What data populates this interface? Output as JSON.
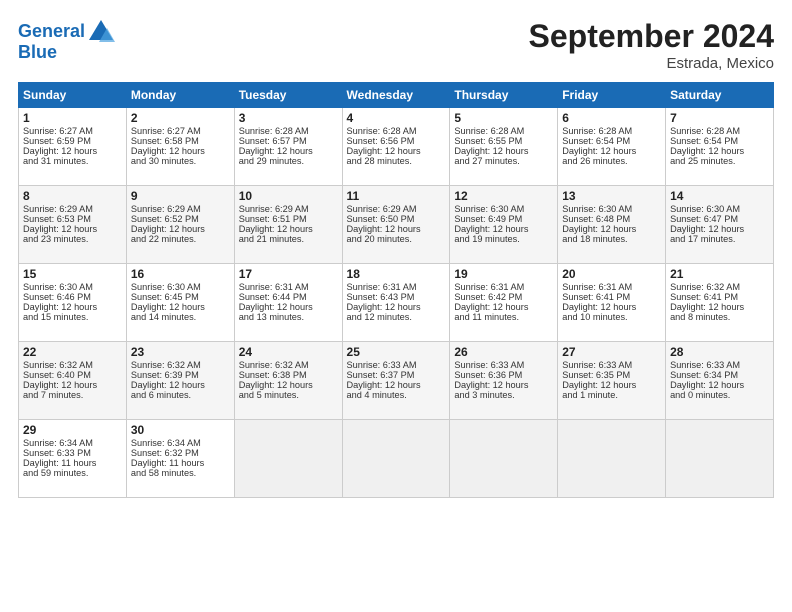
{
  "header": {
    "logo_line1": "General",
    "logo_line2": "Blue",
    "month": "September 2024",
    "location": "Estrada, Mexico"
  },
  "weekdays": [
    "Sunday",
    "Monday",
    "Tuesday",
    "Wednesday",
    "Thursday",
    "Friday",
    "Saturday"
  ],
  "weeks": [
    [
      {
        "day": "1",
        "lines": [
          "Sunrise: 6:27 AM",
          "Sunset: 6:59 PM",
          "Daylight: 12 hours",
          "and 31 minutes."
        ]
      },
      {
        "day": "2",
        "lines": [
          "Sunrise: 6:27 AM",
          "Sunset: 6:58 PM",
          "Daylight: 12 hours",
          "and 30 minutes."
        ]
      },
      {
        "day": "3",
        "lines": [
          "Sunrise: 6:28 AM",
          "Sunset: 6:57 PM",
          "Daylight: 12 hours",
          "and 29 minutes."
        ]
      },
      {
        "day": "4",
        "lines": [
          "Sunrise: 6:28 AM",
          "Sunset: 6:56 PM",
          "Daylight: 12 hours",
          "and 28 minutes."
        ]
      },
      {
        "day": "5",
        "lines": [
          "Sunrise: 6:28 AM",
          "Sunset: 6:55 PM",
          "Daylight: 12 hours",
          "and 27 minutes."
        ]
      },
      {
        "day": "6",
        "lines": [
          "Sunrise: 6:28 AM",
          "Sunset: 6:54 PM",
          "Daylight: 12 hours",
          "and 26 minutes."
        ]
      },
      {
        "day": "7",
        "lines": [
          "Sunrise: 6:28 AM",
          "Sunset: 6:54 PM",
          "Daylight: 12 hours",
          "and 25 minutes."
        ]
      }
    ],
    [
      {
        "day": "8",
        "lines": [
          "Sunrise: 6:29 AM",
          "Sunset: 6:53 PM",
          "Daylight: 12 hours",
          "and 23 minutes."
        ]
      },
      {
        "day": "9",
        "lines": [
          "Sunrise: 6:29 AM",
          "Sunset: 6:52 PM",
          "Daylight: 12 hours",
          "and 22 minutes."
        ]
      },
      {
        "day": "10",
        "lines": [
          "Sunrise: 6:29 AM",
          "Sunset: 6:51 PM",
          "Daylight: 12 hours",
          "and 21 minutes."
        ]
      },
      {
        "day": "11",
        "lines": [
          "Sunrise: 6:29 AM",
          "Sunset: 6:50 PM",
          "Daylight: 12 hours",
          "and 20 minutes."
        ]
      },
      {
        "day": "12",
        "lines": [
          "Sunrise: 6:30 AM",
          "Sunset: 6:49 PM",
          "Daylight: 12 hours",
          "and 19 minutes."
        ]
      },
      {
        "day": "13",
        "lines": [
          "Sunrise: 6:30 AM",
          "Sunset: 6:48 PM",
          "Daylight: 12 hours",
          "and 18 minutes."
        ]
      },
      {
        "day": "14",
        "lines": [
          "Sunrise: 6:30 AM",
          "Sunset: 6:47 PM",
          "Daylight: 12 hours",
          "and 17 minutes."
        ]
      }
    ],
    [
      {
        "day": "15",
        "lines": [
          "Sunrise: 6:30 AM",
          "Sunset: 6:46 PM",
          "Daylight: 12 hours",
          "and 15 minutes."
        ]
      },
      {
        "day": "16",
        "lines": [
          "Sunrise: 6:30 AM",
          "Sunset: 6:45 PM",
          "Daylight: 12 hours",
          "and 14 minutes."
        ]
      },
      {
        "day": "17",
        "lines": [
          "Sunrise: 6:31 AM",
          "Sunset: 6:44 PM",
          "Daylight: 12 hours",
          "and 13 minutes."
        ]
      },
      {
        "day": "18",
        "lines": [
          "Sunrise: 6:31 AM",
          "Sunset: 6:43 PM",
          "Daylight: 12 hours",
          "and 12 minutes."
        ]
      },
      {
        "day": "19",
        "lines": [
          "Sunrise: 6:31 AM",
          "Sunset: 6:42 PM",
          "Daylight: 12 hours",
          "and 11 minutes."
        ]
      },
      {
        "day": "20",
        "lines": [
          "Sunrise: 6:31 AM",
          "Sunset: 6:41 PM",
          "Daylight: 12 hours",
          "and 10 minutes."
        ]
      },
      {
        "day": "21",
        "lines": [
          "Sunrise: 6:32 AM",
          "Sunset: 6:41 PM",
          "Daylight: 12 hours",
          "and 8 minutes."
        ]
      }
    ],
    [
      {
        "day": "22",
        "lines": [
          "Sunrise: 6:32 AM",
          "Sunset: 6:40 PM",
          "Daylight: 12 hours",
          "and 7 minutes."
        ]
      },
      {
        "day": "23",
        "lines": [
          "Sunrise: 6:32 AM",
          "Sunset: 6:39 PM",
          "Daylight: 12 hours",
          "and 6 minutes."
        ]
      },
      {
        "day": "24",
        "lines": [
          "Sunrise: 6:32 AM",
          "Sunset: 6:38 PM",
          "Daylight: 12 hours",
          "and 5 minutes."
        ]
      },
      {
        "day": "25",
        "lines": [
          "Sunrise: 6:33 AM",
          "Sunset: 6:37 PM",
          "Daylight: 12 hours",
          "and 4 minutes."
        ]
      },
      {
        "day": "26",
        "lines": [
          "Sunrise: 6:33 AM",
          "Sunset: 6:36 PM",
          "Daylight: 12 hours",
          "and 3 minutes."
        ]
      },
      {
        "day": "27",
        "lines": [
          "Sunrise: 6:33 AM",
          "Sunset: 6:35 PM",
          "Daylight: 12 hours",
          "and 1 minute."
        ]
      },
      {
        "day": "28",
        "lines": [
          "Sunrise: 6:33 AM",
          "Sunset: 6:34 PM",
          "Daylight: 12 hours",
          "and 0 minutes."
        ]
      }
    ],
    [
      {
        "day": "29",
        "lines": [
          "Sunrise: 6:34 AM",
          "Sunset: 6:33 PM",
          "Daylight: 11 hours",
          "and 59 minutes."
        ]
      },
      {
        "day": "30",
        "lines": [
          "Sunrise: 6:34 AM",
          "Sunset: 6:32 PM",
          "Daylight: 11 hours",
          "and 58 minutes."
        ]
      },
      {
        "day": "",
        "lines": []
      },
      {
        "day": "",
        "lines": []
      },
      {
        "day": "",
        "lines": []
      },
      {
        "day": "",
        "lines": []
      },
      {
        "day": "",
        "lines": []
      }
    ]
  ]
}
